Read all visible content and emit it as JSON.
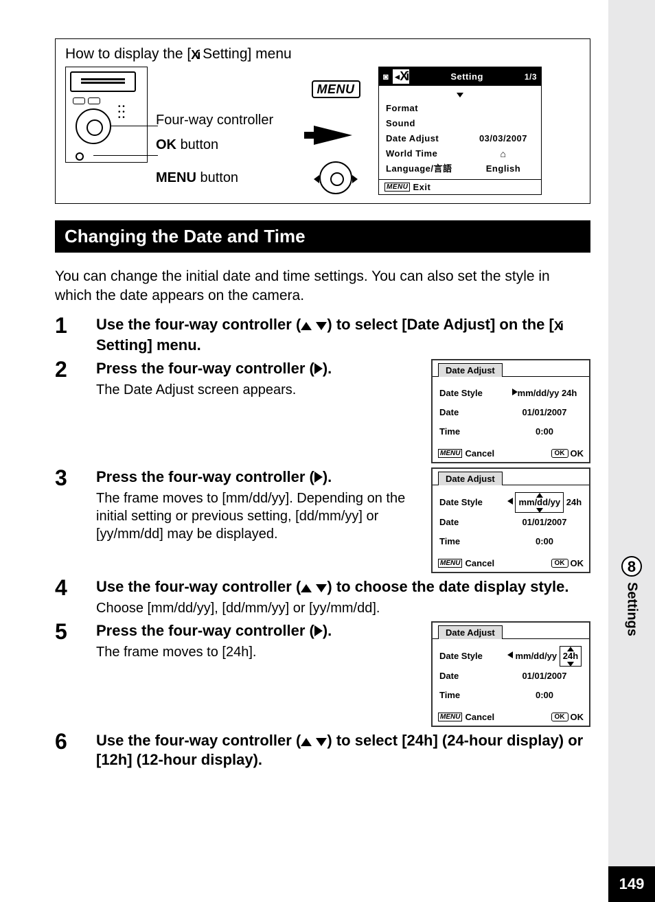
{
  "intro": {
    "title_pre": "How to display the [",
    "title_post": " Setting] menu",
    "label_fourway": "Four-way controller",
    "label_ok": "button",
    "label_ok_bold": "OK",
    "label_menu": "button",
    "label_menu_bold": "MENU",
    "menu_badge": "MENU"
  },
  "setting_lcd": {
    "title": "Setting",
    "page": "1/3",
    "items": {
      "format": "Format",
      "sound": "Sound",
      "date_adjust": "Date Adjust",
      "world_time": "World Time",
      "language": "Language/言語"
    },
    "values": {
      "date": "03/03/2007",
      "lang": "English"
    },
    "footer": "Exit"
  },
  "section_title": "Changing the Date and Time",
  "lead": "You can change the initial date and time settings. You can also set the style in which the date appears on the camera.",
  "steps": {
    "s1_a": "Use the four-way controller (",
    "s1_b": ") to select [Date Adjust] on the [",
    "s1_c": " Setting] menu.",
    "s2_h": "Press the four-way controller (",
    "s2_h2": ").",
    "s2_sub": "The Date Adjust screen appears.",
    "s3_h": "Press the four-way controller (",
    "s3_h2": ").",
    "s3_sub": "The frame moves to [mm/dd/yy]. Depending on the initial setting or previous setting, [dd/mm/yy] or [yy/mm/dd] may be displayed.",
    "s4_a": "Use the four-way controller (",
    "s4_b": ") to choose the date display style.",
    "s4_sub": "Choose [mm/dd/yy], [dd/mm/yy] or [yy/mm/dd].",
    "s5_h": "Press the four-way controller (",
    "s5_h2": ").",
    "s5_sub": "The frame moves to [24h].",
    "s6_a": "Use the four-way controller (",
    "s6_b": ") to select [24h] (24-hour display) or [12h] (12-hour display)."
  },
  "date_adjust": {
    "tab": "Date Adjust",
    "date_style": "Date Style",
    "date": "Date",
    "time": "Time",
    "style_val": "mm/dd/yy",
    "hour_val": "24h",
    "date_val": "01/01/2007",
    "time_val": "0:00",
    "cancel": "Cancel",
    "ok": "OK"
  },
  "side": {
    "num": "8",
    "label": "Settings",
    "page": "149"
  }
}
